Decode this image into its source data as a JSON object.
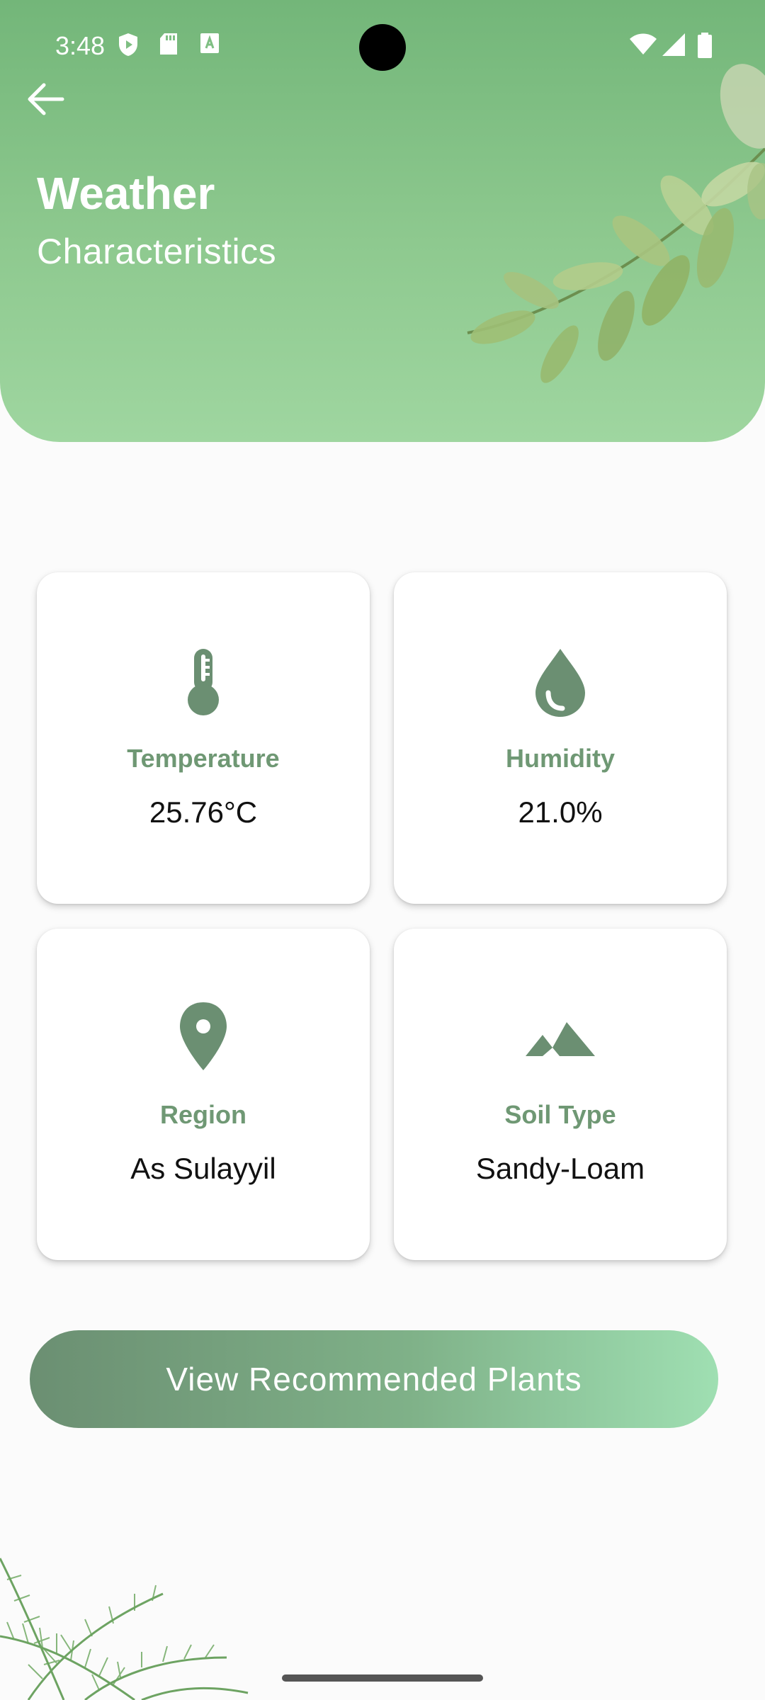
{
  "status_bar": {
    "time": "3:48"
  },
  "header": {
    "title": "Weather",
    "subtitle": "Characteristics"
  },
  "cards": [
    {
      "label": "Temperature",
      "value": "25.76°C",
      "icon": "thermometer-icon"
    },
    {
      "label": "Humidity",
      "value": "21.0%",
      "icon": "water-drop-icon"
    },
    {
      "label": "Region",
      "value": "As Sulayyil",
      "icon": "location-pin-icon"
    },
    {
      "label": "Soil Type",
      "value": "Sandy-Loam",
      "icon": "terrain-icon"
    }
  ],
  "cta": {
    "label": "View Recommended Plants"
  },
  "colors": {
    "header_green": "#8ec98f",
    "icon_green": "#6b8f72",
    "label_green": "#6f9874"
  }
}
